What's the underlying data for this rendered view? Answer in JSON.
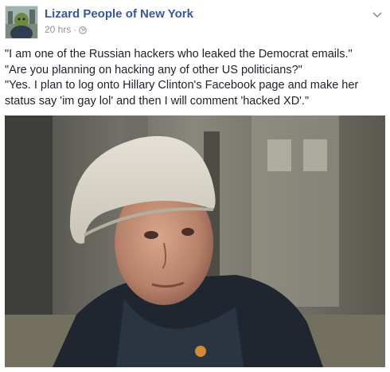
{
  "post": {
    "page_name": "Lizard People of New York",
    "timestamp": "20 hrs",
    "separator": "·",
    "privacy_icon": "globe-icon",
    "menu_icon": "chevron-down-icon",
    "lines": [
      "\"I am one of the Russian hackers who leaked the Democrat emails.\"",
      "\"Are you planning on hacking any of other US politicians?\"",
      "\"Yes. I plan to log onto Hillary Clinton's Facebook page and make her status say 'im gay lol' and then I will comment 'hacked XD'.\""
    ]
  },
  "colors": {
    "page_name": "#365899",
    "meta": "#90949c",
    "text": "#1d2129"
  }
}
